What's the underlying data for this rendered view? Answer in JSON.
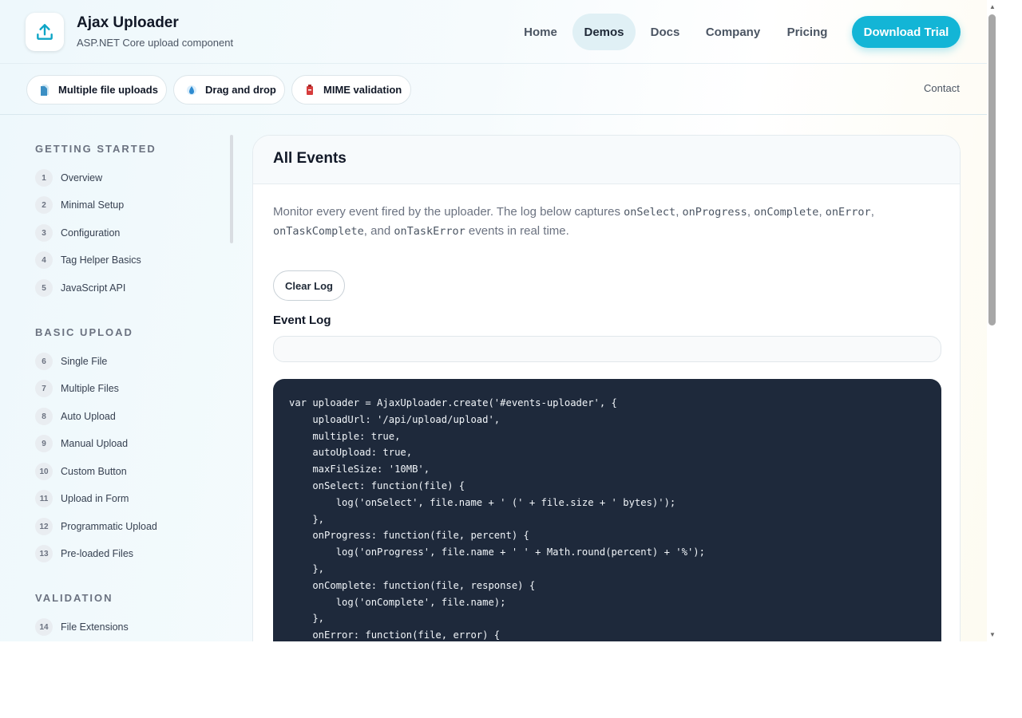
{
  "brand": {
    "title": "Ajax Uploader",
    "subtitle": "ASP.NET Core upload component"
  },
  "nav": [
    {
      "label": "Home",
      "active": false
    },
    {
      "label": "Demos",
      "active": true
    },
    {
      "label": "Docs",
      "active": false
    },
    {
      "label": "Company",
      "active": false
    },
    {
      "label": "Pricing",
      "active": false
    }
  ],
  "cta": {
    "label": "Download Trial"
  },
  "subbar": {
    "pills": [
      {
        "label": "Multiple file uploads",
        "icon": "files-icon"
      },
      {
        "label": "Drag and drop",
        "icon": "drop-icon"
      },
      {
        "label": "MIME validation",
        "icon": "file-badge-icon"
      }
    ],
    "contact": "Contact"
  },
  "sidebar": {
    "sections": [
      {
        "title": "GETTING STARTED",
        "items": [
          {
            "num": "1",
            "label": "Overview"
          },
          {
            "num": "2",
            "label": "Minimal Setup"
          },
          {
            "num": "3",
            "label": "Configuration"
          },
          {
            "num": "4",
            "label": "Tag Helper Basics"
          },
          {
            "num": "5",
            "label": "JavaScript API"
          }
        ]
      },
      {
        "title": "BASIC UPLOAD",
        "items": [
          {
            "num": "6",
            "label": "Single File"
          },
          {
            "num": "7",
            "label": "Multiple Files"
          },
          {
            "num": "8",
            "label": "Auto Upload"
          },
          {
            "num": "9",
            "label": "Manual Upload"
          },
          {
            "num": "10",
            "label": "Custom Button"
          },
          {
            "num": "11",
            "label": "Upload in Form"
          },
          {
            "num": "12",
            "label": "Programmatic Upload"
          },
          {
            "num": "13",
            "label": "Pre-loaded Files"
          }
        ]
      },
      {
        "title": "VALIDATION",
        "items": [
          {
            "num": "14",
            "label": "File Extensions"
          }
        ]
      }
    ]
  },
  "main": {
    "title": "All Events",
    "description": {
      "intro": "Monitor every event fired by the uploader. The log below captures ",
      "events": [
        "onSelect",
        "onProgress",
        "onComplete",
        "onError",
        "onTaskComplete",
        "onTaskError"
      ],
      "and": "and",
      "outro": " events in real time."
    },
    "clear_button": "Clear Log",
    "log_label": "Event Log",
    "log_value": "",
    "code": "var uploader = AjaxUploader.create('#events-uploader', {\n    uploadUrl: '/api/upload/upload',\n    multiple: true,\n    autoUpload: true,\n    maxFileSize: '10MB',\n    onSelect: function(file) {\n        log('onSelect', file.name + ' (' + file.size + ' bytes)');\n    },\n    onProgress: function(file, percent) {\n        log('onProgress', file.name + ' ' + Math.round(percent) + '%');\n    },\n    onComplete: function(file, response) {\n        log('onComplete', file.name);\n    },\n    onError: function(file, error) {"
  }
}
